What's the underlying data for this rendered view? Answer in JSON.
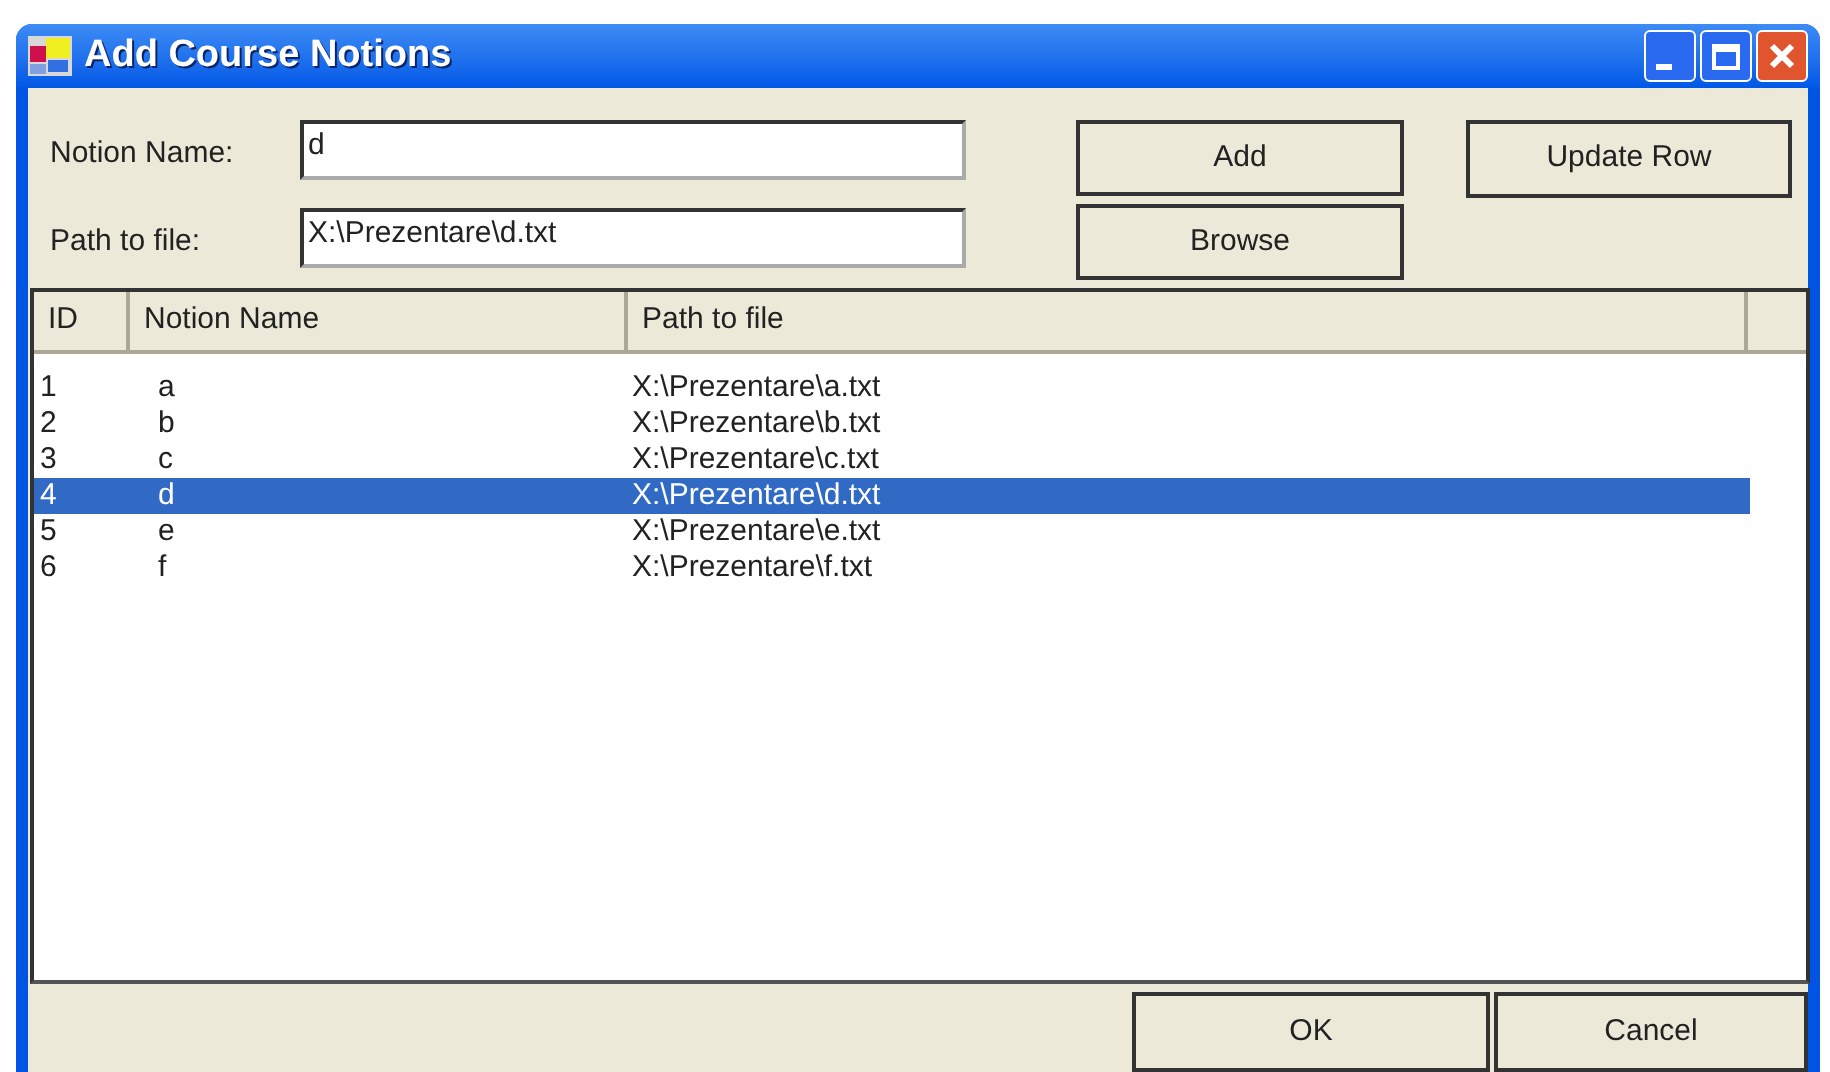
{
  "window": {
    "title": "Add Course Notions"
  },
  "fields": [
    {
      "label": "Notion Name:",
      "value": "d"
    },
    {
      "label": "Path to file:",
      "value": "X:\\Prezentare\\d.txt"
    }
  ],
  "buttons": {
    "add": "Add",
    "browse": "Browse",
    "update": "Update Row"
  },
  "table": {
    "columns": [
      "ID",
      "Notion Name",
      "Path to file"
    ],
    "rows": [
      {
        "id": "1",
        "name": "a",
        "path": "X:\\Prezentare\\a.txt",
        "selected": false
      },
      {
        "id": "2",
        "name": "b",
        "path": "X:\\Prezentare\\b.txt",
        "selected": false
      },
      {
        "id": "3",
        "name": "c",
        "path": "X:\\Prezentare\\c.txt",
        "selected": false
      },
      {
        "id": "4",
        "name": "d",
        "path": "X:\\Prezentare\\d.txt",
        "selected": true
      },
      {
        "id": "5",
        "name": "e",
        "path": "X:\\Prezentare\\e.txt",
        "selected": false
      },
      {
        "id": "6",
        "name": "f",
        "path": "X:\\Prezentare\\f.txt",
        "selected": false
      }
    ]
  },
  "footer_buttons": [
    "OK",
    "Cancel"
  ]
}
